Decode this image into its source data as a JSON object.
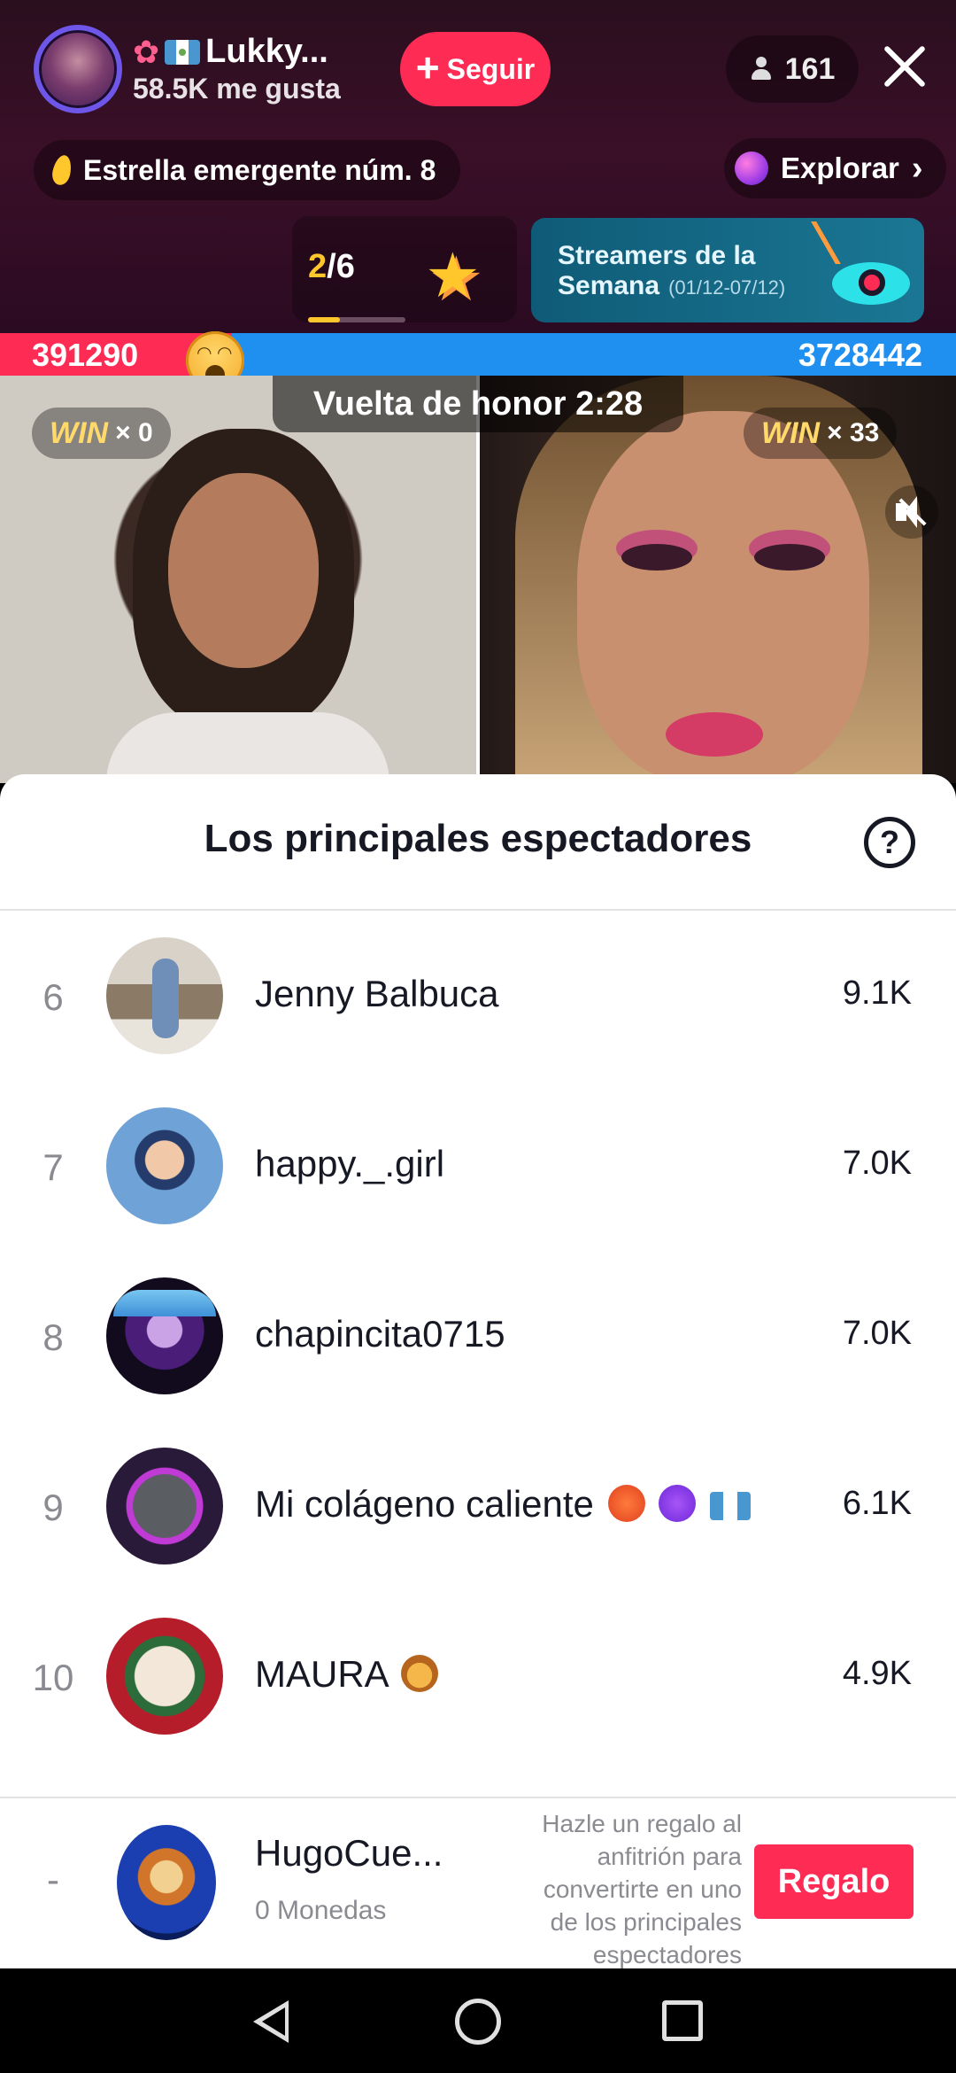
{
  "header": {
    "host_name": "Lukky...",
    "likes": "58.5K me gusta",
    "follow_label": "Seguir",
    "viewer_count": "161",
    "rank_label": "Estrella emergente núm. 8",
    "explore_label": "Explorar",
    "page_current": "2",
    "page_total": "/6",
    "page_progress": 0.33,
    "weekly_title_1": "Streamers de la",
    "weekly_title_2": "Semana",
    "weekly_date": "(01/12-07/12)"
  },
  "battle": {
    "score_left": "391290",
    "score_right": "3728442",
    "honor_lap": "Vuelta de honor 2:28",
    "win_label": "WIN",
    "win_left": "× 0",
    "win_right": "× 33"
  },
  "sheet": {
    "title": "Los principales espectadores",
    "help": "?",
    "rows": [
      {
        "rank": "6",
        "name": "Jenny Balbuca",
        "score": "9.1K"
      },
      {
        "rank": "7",
        "name": "happy._.girl",
        "score": "7.0K"
      },
      {
        "rank": "8",
        "name": "chapincita0715",
        "score": "7.0K"
      },
      {
        "rank": "9",
        "name": "Mi colágeno caliente",
        "score": "6.1K"
      },
      {
        "rank": "10",
        "name": "MAURA",
        "score": "4.9K"
      }
    ]
  },
  "self": {
    "rank": "-",
    "name": "HugoCue...",
    "coins": "0 Monedas",
    "hint": "Hazle un regalo al anfitrión para convertirte en uno de los principales espectadores",
    "gift_label": "Regalo"
  },
  "colors": {
    "accent": "#fe2c55",
    "blue": "#1f8ff0",
    "gold": "#ffc72c"
  }
}
